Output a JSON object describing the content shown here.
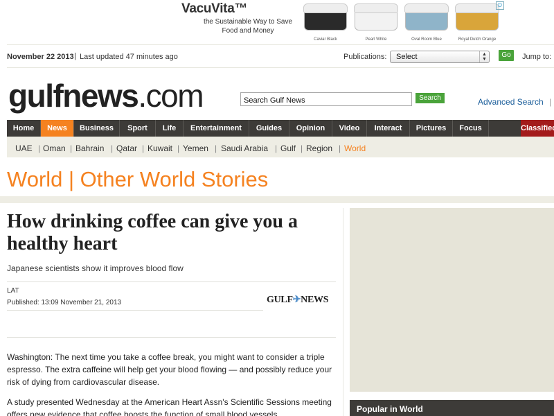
{
  "ad": {
    "brand": "VacuVita™",
    "tagline": "the Sustainable Way to Save Food and Money",
    "products": [
      {
        "name": "Caviar Black",
        "color": "#2a2a2a"
      },
      {
        "name": "Pearl White",
        "color": "#f2f2f2"
      },
      {
        "name": "Oval Room Blue",
        "color": "#8fb4c9"
      },
      {
        "name": "Royal Dutch Orange",
        "color": "#d9a53a"
      }
    ],
    "choice_icon": "D"
  },
  "datebar": {
    "date": "November 22 2013",
    "separator": "|",
    "updated": "Last updated 47 minutes ago",
    "publications_label": "Publications:",
    "publications_value": "Select",
    "go_label": "Go",
    "jump_label": "Jump to:"
  },
  "logo": {
    "bold": "gulfnews",
    "light": ".com"
  },
  "search": {
    "placeholder": "Search Gulf News",
    "button": "Search",
    "advanced": "Advanced Search",
    "advanced_sep": "|"
  },
  "mainnav": [
    {
      "label": "Home"
    },
    {
      "label": "News",
      "active": true
    },
    {
      "label": "Business"
    },
    {
      "label": "Sport"
    },
    {
      "label": "Life"
    },
    {
      "label": "Entertainment"
    },
    {
      "label": "Guides"
    },
    {
      "label": "Opinion"
    },
    {
      "label": "Video"
    },
    {
      "label": "Interact"
    },
    {
      "label": "Pictures"
    },
    {
      "label": "Focus"
    },
    {
      "label": "Classifieds",
      "classified": true
    }
  ],
  "subnav": {
    "items": [
      "UAE",
      "Oman",
      "Bahrain",
      "Qatar",
      "Kuwait",
      "Yemen",
      "Saudi Arabia",
      "Gulf",
      "Region",
      "World"
    ],
    "separator": "|",
    "active": "World"
  },
  "section_title": "World | Other World Stories",
  "article": {
    "headline": "How drinking coffee can give you a healthy heart",
    "subhead": "Japanese scientists show it improves blood flow",
    "byline": "LAT",
    "published": "Published: 13:09 November 21, 2013",
    "source_logo_left": "GULF",
    "source_logo_right": "NEWS",
    "source_logo_icon": "✈",
    "paragraphs": [
      "Washington: The next time you take a coffee break, you might want to consider a triple espresso. The extra caffeine will help get your blood flowing — and possibly reduce your risk of dying from cardiovascular disease.",
      "A study presented Wednesday at the American Heart Assn's Scientific Sessions meeting offers new evidence that coffee boosts the function of small blood vessels."
    ]
  },
  "rail": {
    "popular_title": "Popular in World"
  },
  "colors": {
    "accent": "#f58220",
    "nav_bg": "#3d3b38",
    "classified_bg": "#a31b1b",
    "link": "#1a5d9a",
    "button_green": "#4aa33a",
    "subnav_bg": "#eeede4"
  }
}
